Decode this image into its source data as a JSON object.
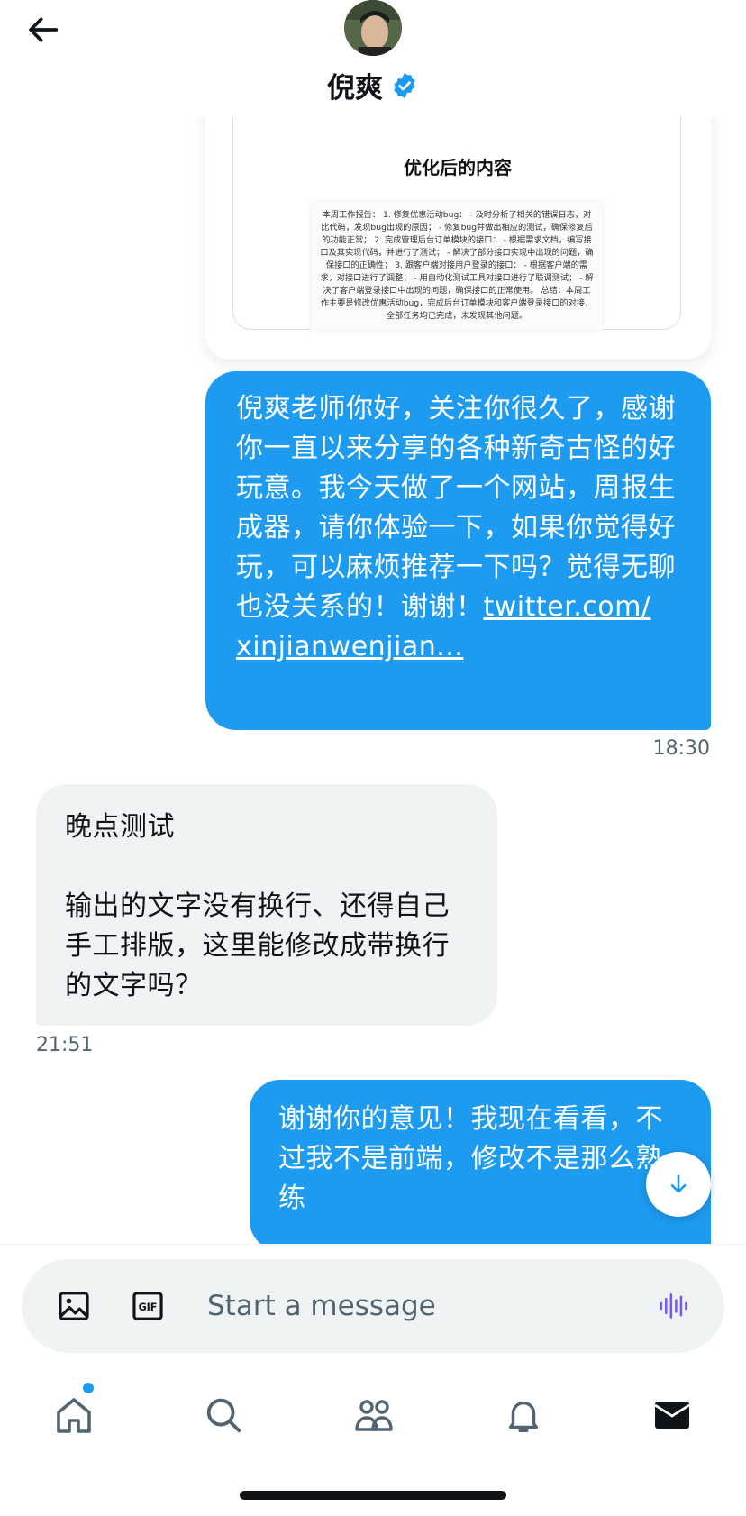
{
  "header": {
    "name": "倪爽",
    "back_icon": "arrow-left-icon",
    "verified_icon": "verified-badge-icon",
    "verified_color": "#1d9bf0"
  },
  "shared_card": {
    "title": "优化后的内容",
    "doc_text": "本周工作报告： 1. 修复优惠活动bug： - 及时分析了相关的错误日志，对比代码，发现bug出现的原因； - 修复bug并做出相应的测试，确保修复后的功能正常； 2. 完成管理后台订单模块的接口： - 根据需求文档，编写接口及其实现代码，并进行了测试； - 解决了部分接口实现中出现的问题，确保接口的正确性； 3. 跟客户端对接用户登录的接口： - 根据客户端的需求，对接口进行了调整； - 用自动化测试工具对接口进行了联调测试； - 解决了客户端登录接口中出现的问题，确保接口的正常使用。 总结：本周工作主要是修改优惠活动bug，完成后台订单模块和客户端登录接口的对接，全部任务均已完成，未发现其他问题。"
  },
  "messages": [
    {
      "direction": "out",
      "text": "倪爽老师你好，关注你很久了，感谢你一直以来分享的各种新奇古怪的好玩意。我今天做了一个网站，周报生成器，请你体验一下，如果你觉得好玩，可以麻烦推荐一下吗？觉得无聊也没关系的！谢谢！",
      "link": "twitter.com/\nxinjianwenjian...",
      "time": "18:30"
    },
    {
      "direction": "in",
      "text": "晚点测试\n\n输出的文字没有换行、还得自己手工排版，这里能修改成带换行的文字吗？",
      "time": "21:51"
    },
    {
      "direction": "out",
      "text": "谢谢你的意见！我现在看看，不过我不是前端，修改不是那么熟练"
    }
  ],
  "composer": {
    "placeholder": "Start a message",
    "image_icon": "image-icon",
    "gif_icon": "gif-icon",
    "gif_label": "GIF",
    "voice_icon": "voice-waveform-icon",
    "voice_color": "#7856ff"
  },
  "nav": {
    "items": [
      "home-icon",
      "search-icon",
      "communities-icon",
      "notifications-icon",
      "messages-icon"
    ],
    "active": "messages-icon",
    "dot_color": "#1d9bf0"
  },
  "colors": {
    "accent": "#1d9bf0",
    "incoming_bubble": "#eff3f4",
    "text": "#0f1419",
    "secondary_text": "#536471"
  }
}
